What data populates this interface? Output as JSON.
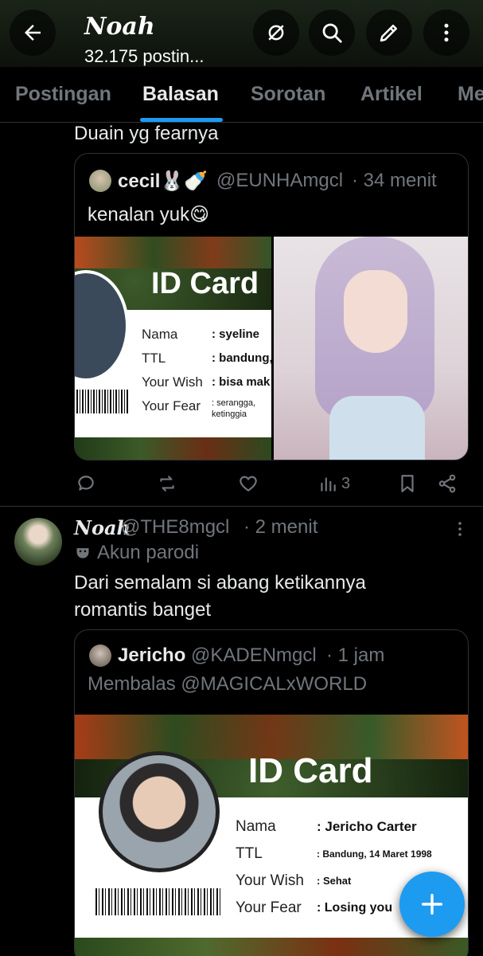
{
  "header": {
    "name": "Noah",
    "post_count": "32.175 postin..."
  },
  "tabs": [
    "Postingan",
    "Balasan",
    "Sorotan",
    "Artikel",
    "Me"
  ],
  "post1": {
    "text": "Duain yg fearnya",
    "quote": {
      "name": "cecil🐰🍼",
      "handle": "@EUNHAmgcl",
      "time": "· 34 menit",
      "text": "kenalan yuk😋",
      "idcard": {
        "title": "ID Card",
        "labels": [
          "Nama",
          "TTL",
          "Your Wish",
          "Your Fear"
        ],
        "values": [
          ": syeline",
          ": bandung,",
          ": bisa mak",
          ": serangga,\nketinggia"
        ]
      }
    },
    "actions": {
      "views": "3"
    }
  },
  "post2": {
    "name": "Noah",
    "handle": "@THE8mgcl",
    "time": "· 2 menit",
    "badge": "Akun parodi",
    "text_line1": "Dari semalam  si abang ketikannya",
    "text_line2": "romantis banget",
    "quote": {
      "name": "Jericho",
      "handle": "@KADENmgcl",
      "time": "· 1 jam",
      "reply_to": "Membalas @MAGICALxWORLD",
      "idcard": {
        "title": "ID Card",
        "labels": [
          "Nama",
          "TTL",
          "Your Wish",
          "Your Fear"
        ],
        "values": [
          ": Jericho Carter",
          ": Bandung, 14 Maret 1998",
          ": Sehat",
          ": Losing you"
        ]
      }
    }
  },
  "colors": {
    "accent": "#1d9bf0",
    "muted": "#71767b",
    "border": "#2f3336"
  }
}
